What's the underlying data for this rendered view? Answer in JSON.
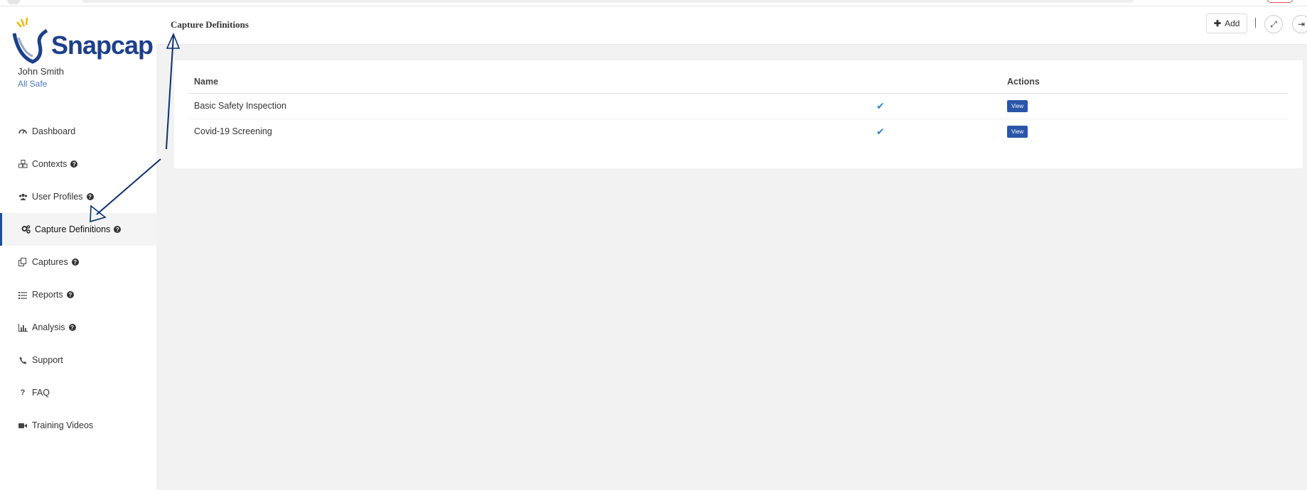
{
  "app": {
    "logo_text": "Snapcap"
  },
  "user": {
    "name": "John Smith",
    "org": "All Safe"
  },
  "sidebar": {
    "items": [
      {
        "label": "Dashboard",
        "icon": "dashboard-icon",
        "help": false,
        "active": false
      },
      {
        "label": "Contexts",
        "icon": "cubes-icon",
        "help": true,
        "active": false
      },
      {
        "label": "User Profiles",
        "icon": "users-icon",
        "help": true,
        "active": false
      },
      {
        "label": "Capture Definitions",
        "icon": "gears-icon",
        "help": true,
        "active": true
      },
      {
        "label": "Captures",
        "icon": "copy-icon",
        "help": true,
        "active": false
      },
      {
        "label": "Reports",
        "icon": "list-icon",
        "help": true,
        "active": false
      },
      {
        "label": "Analysis",
        "icon": "bar-chart-icon",
        "help": true,
        "active": false
      },
      {
        "label": "Support",
        "icon": "phone-icon",
        "help": false,
        "active": false
      },
      {
        "label": "FAQ",
        "icon": "question-icon",
        "help": false,
        "active": false
      },
      {
        "label": "Training Videos",
        "icon": "video-icon",
        "help": false,
        "active": false
      }
    ]
  },
  "header": {
    "title": "Capture Definitions",
    "add_label": "Add",
    "add_icon": "plus-icon",
    "expand_icon": "expand-icon",
    "logout_icon": "sign-out-icon"
  },
  "table": {
    "columns": [
      "Name",
      "",
      "Actions"
    ],
    "rows": [
      {
        "name": "Basic Safety Inspection",
        "active": true,
        "action": "View"
      },
      {
        "name": "Covid-19 Screening",
        "active": true,
        "action": "View"
      }
    ]
  },
  "colors": {
    "accent": "#1d4e9e",
    "view_button": "#2a55a8",
    "check": "#2a8bd0",
    "annotation_arrow": "#0b2f6e"
  }
}
